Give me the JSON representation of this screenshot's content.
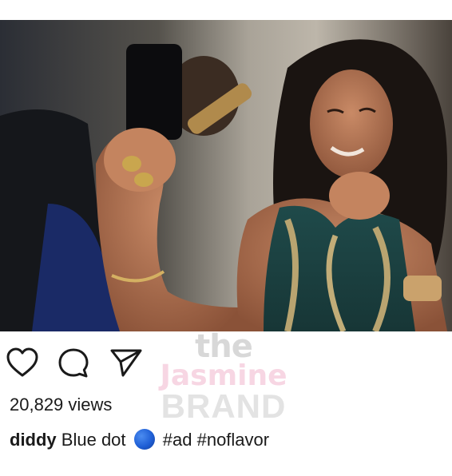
{
  "post": {
    "views_text": "20,829 views",
    "username": "diddy",
    "caption_text": "Blue dot",
    "emoji": "blue-circle-emoji",
    "hashtags": "#ad #noflavor"
  },
  "watermark": {
    "line1": "the",
    "line2": "Jasmine",
    "line3": "BRAND"
  },
  "icons": {
    "like": "heart-icon",
    "comment": "comment-icon",
    "share": "send-icon"
  },
  "colors": {
    "text": "#1a1a1a",
    "blue_dot": "#1f5fd6",
    "watermark_pink": "#f7d6e3",
    "watermark_gray": "#d8d8d8"
  }
}
